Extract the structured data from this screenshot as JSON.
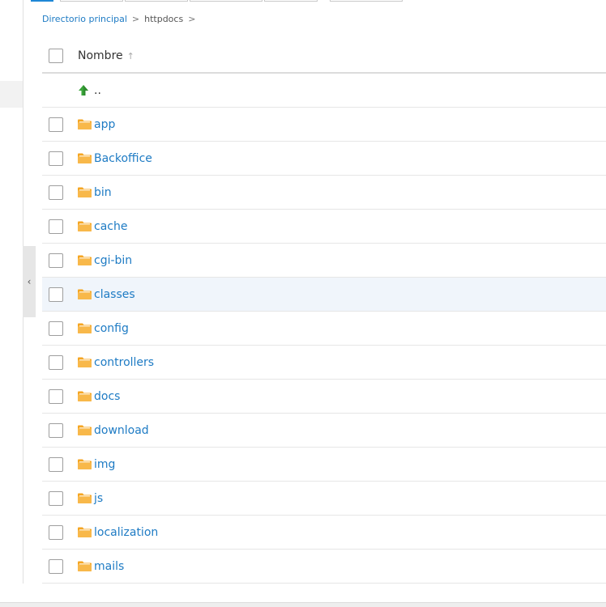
{
  "breadcrumb": {
    "home": "Directorio principal",
    "current": "httpdocs",
    "separator": ">"
  },
  "table": {
    "header": {
      "name_label": "Nombre",
      "sort_indicator": "↑"
    },
    "parent_label": "..",
    "rows": [
      {
        "name": "app"
      },
      {
        "name": "Backoffice"
      },
      {
        "name": "bin"
      },
      {
        "name": "cache"
      },
      {
        "name": "cgi-bin"
      },
      {
        "name": "classes"
      },
      {
        "name": "config"
      },
      {
        "name": "controllers"
      },
      {
        "name": "docs"
      },
      {
        "name": "download"
      },
      {
        "name": "img"
      },
      {
        "name": "js"
      },
      {
        "name": "localization"
      },
      {
        "name": "mails"
      }
    ]
  },
  "sidebar": {
    "collapse_glyph": "‹"
  },
  "icons": {
    "folder": "folder-icon",
    "parent": "up-arrow-icon",
    "collapse": "chevron-left-icon"
  },
  "colors": {
    "link": "#1e7bc4",
    "folder": "#f5a623",
    "up_arrow": "#3aa53a",
    "accent": "#1e87d6",
    "row_highlight": "#f0f5fb"
  }
}
